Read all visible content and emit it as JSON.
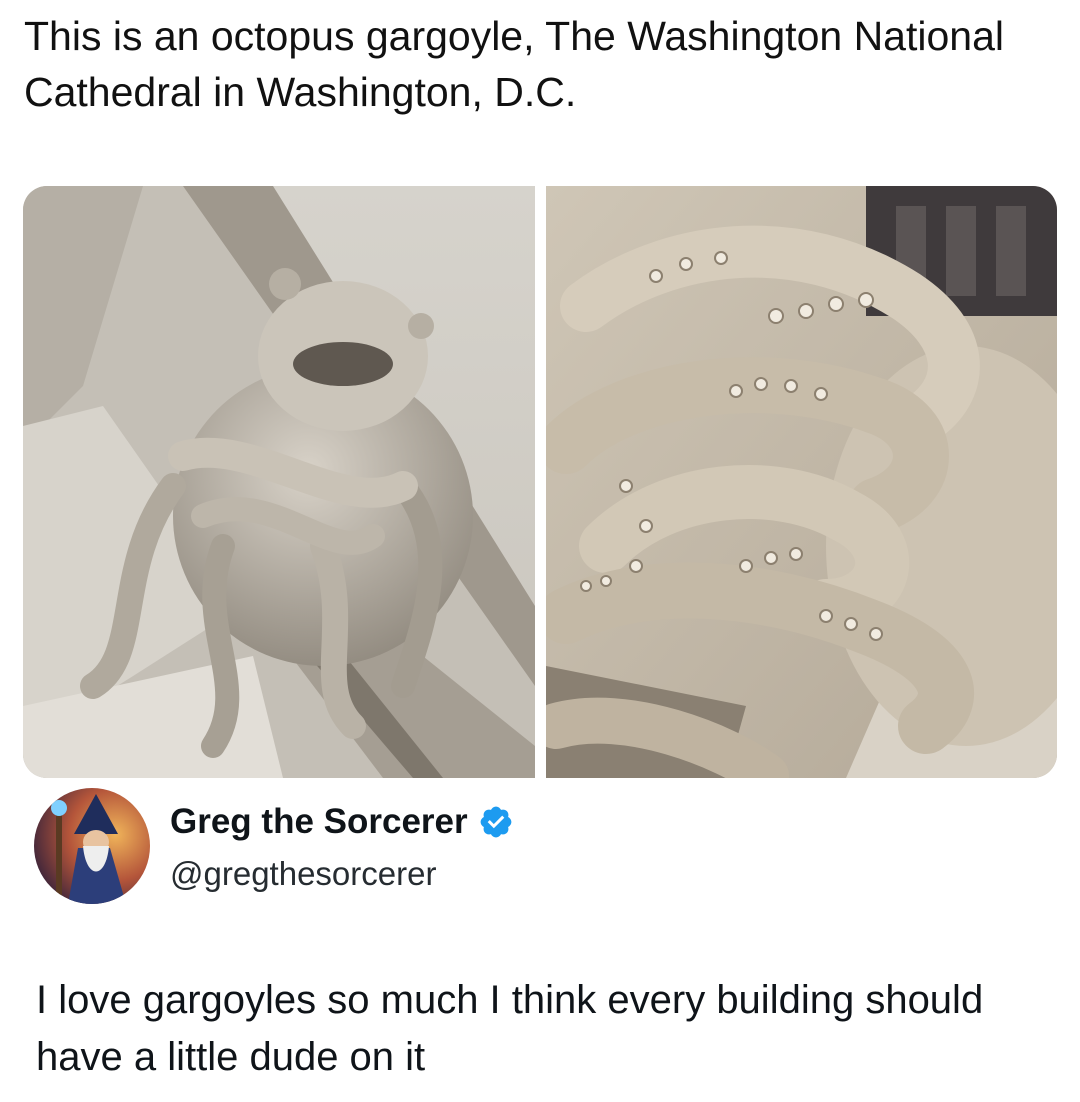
{
  "caption": {
    "text": "This is an octopus gargoyle,  The Washington National Cathedral in Washington, D.C."
  },
  "media": {
    "images": [
      {
        "subject": "octopus-gargoyle-full-view"
      },
      {
        "subject": "octopus-gargoyle-close-up"
      }
    ]
  },
  "tweet": {
    "author": {
      "display_name": "Greg the Sorcerer",
      "handle": "@gregthesorcerer",
      "verified": true,
      "verified_color": "#1d9bf0",
      "avatar_icon": "wizard-avatar"
    },
    "text": "I love gargoyles so much I think every building should have a little dude on it"
  }
}
